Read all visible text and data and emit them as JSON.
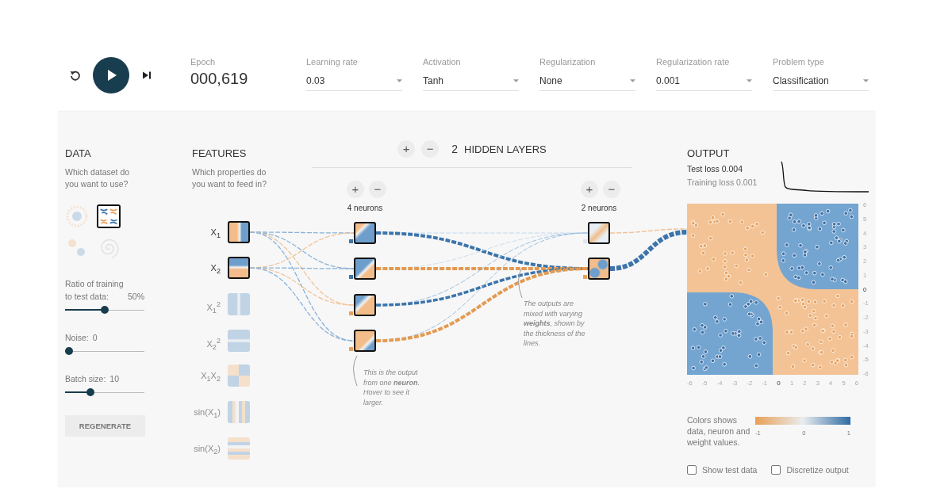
{
  "controls": {
    "playing": false
  },
  "epoch": {
    "label": "Epoch",
    "value": "000,619"
  },
  "dropdowns": [
    {
      "label": "Learning rate",
      "value": "0.03"
    },
    {
      "label": "Activation",
      "value": "Tanh"
    },
    {
      "label": "Regularization",
      "value": "None"
    },
    {
      "label": "Regularization rate",
      "value": "0.001"
    },
    {
      "label": "Problem type",
      "value": "Classification"
    }
  ],
  "data": {
    "title": "DATA",
    "description": "Which dataset do you want to use?",
    "datasets": [
      {
        "kind": "circle",
        "selected": false
      },
      {
        "kind": "xor",
        "selected": true
      },
      {
        "kind": "gauss",
        "selected": false
      },
      {
        "kind": "spiral",
        "selected": false
      }
    ],
    "sliders": [
      {
        "label": "Ratio of training to test data:",
        "value": "50%",
        "level": 0.5
      },
      {
        "label": "Noise:",
        "value": "0",
        "level": 0
      },
      {
        "label": "Batch size:",
        "value": "10",
        "level": 0.3
      }
    ],
    "regenerate": "REGENERATE"
  },
  "features": {
    "title": "FEATURES",
    "description": "Which properties do you want to feed in?",
    "inputs": [
      {
        "label": "X$_{1}$",
        "kind": "x1",
        "selected": true
      },
      {
        "label": "X$_{2}$",
        "kind": "x2",
        "selected": true
      },
      {
        "label": "X$_{1}$$^{2}$",
        "kind": "x1sq",
        "selected": false
      },
      {
        "label": "X$_{2}$$^{2}$",
        "kind": "x2sq",
        "selected": false
      },
      {
        "label": "X$_{1}$X$_{2}$",
        "kind": "x1x2",
        "selected": false
      },
      {
        "label": "sin(X$_{1}$)",
        "kind": "sinx1",
        "selected": false
      },
      {
        "label": "sin(X$_{2}$)",
        "kind": "sinx2",
        "selected": false
      }
    ]
  },
  "network": {
    "add": "+",
    "remove": "−",
    "count": "2",
    "label": "HIDDEN LAYERS",
    "layers": [
      {
        "add": "+",
        "remove": "−",
        "label": "4 neurons",
        "neurons": [
          {
            "color": "#3f76ad"
          },
          {
            "color": "#3f76ad"
          },
          {
            "color": "#eba05a"
          },
          {
            "color": "#eba05a"
          }
        ]
      },
      {
        "add": "+",
        "remove": "−",
        "label": "2 neurons",
        "neurons": [
          {
            "color": "#e3e6e8"
          },
          {
            "color": "#eba05a"
          }
        ]
      }
    ],
    "notes": [
      "This is the output from one **neuron**. Hover to see it larger.",
      "The outputs are mixed with varying **weights**, shown by the thickness of the lines."
    ]
  },
  "output": {
    "title": "OUTPUT",
    "test_loss": "Test loss 0.004",
    "training_loss": "Training loss 0.001",
    "y_ticks": [
      "6",
      "5",
      "4",
      "3",
      "2",
      "1",
      "0",
      "-1",
      "-2",
      "-3",
      "-4",
      "-5",
      "-6"
    ],
    "x_ticks": [
      "-6",
      "-5",
      "-4",
      "-3",
      "-2",
      "-1",
      "0",
      "1",
      "2",
      "3",
      "4",
      "5",
      "6"
    ],
    "legend": "Colors shows data, neuron and weight values.",
    "scale": [
      "-1",
      "0",
      "1"
    ],
    "checkboxes": [
      {
        "label": "Show test data",
        "checked": false
      },
      {
        "label": "Discretize output",
        "checked": false
      }
    ]
  }
}
